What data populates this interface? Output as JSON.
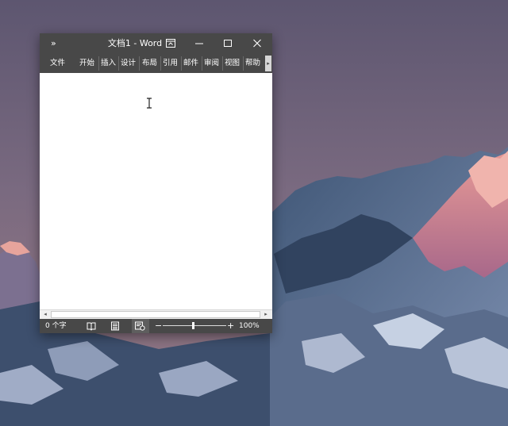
{
  "window": {
    "title": "文档1  -  Word",
    "expand_glyph": "»"
  },
  "ribbon": {
    "tabs": [
      "文件",
      "开始",
      "插入",
      "设计",
      "布局",
      "引用",
      "邮件",
      "审阅",
      "视图",
      "帮助"
    ],
    "scroll_glyph": "▸"
  },
  "hscroll": {
    "left_glyph": "◂",
    "right_glyph": "▸"
  },
  "statusbar": {
    "word_count": "0 个字",
    "zoom_minus": "−",
    "zoom_plus": "+",
    "zoom_label": "100%",
    "zoom_level": 1.0
  },
  "icons": {
    "expand": "expand-ribbon-icon",
    "ribbon_display": "ribbon-display-options-icon",
    "minimize": "minimize-icon",
    "maximize": "maximize-icon",
    "close": "close-icon",
    "cursor": "text-cursor-icon",
    "read_mode": "read-mode-icon",
    "print_layout": "print-layout-icon",
    "web_layout": "web-layout-icon"
  },
  "colors": {
    "chrome": "#484848",
    "page": "#ffffff",
    "sky": "#6f6578"
  }
}
